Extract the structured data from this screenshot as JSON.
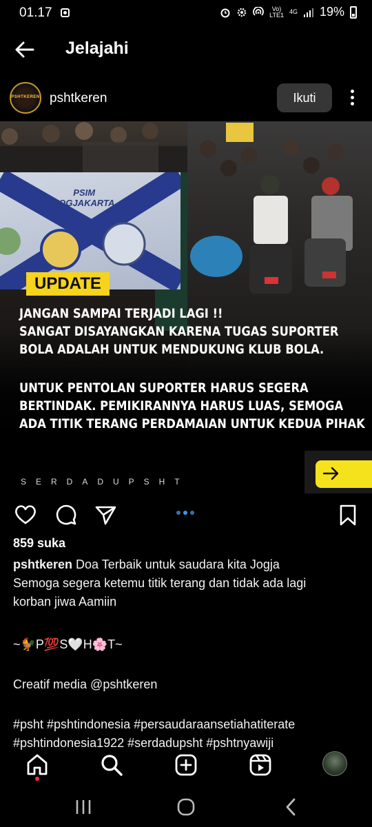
{
  "status_bar": {
    "time": "01.17",
    "network_label_top": "Vo)",
    "network_label_bottom": "LTE1",
    "network_type": "4G",
    "battery": "19%",
    "icons": [
      "screenshot-icon",
      "alarm-icon",
      "hotspot-icon",
      "signal-icon",
      "battery-icon"
    ]
  },
  "header": {
    "back_icon": "arrow-left-icon",
    "title": "Jelajahi"
  },
  "post": {
    "avatar_text": "PSHTKEREN",
    "username": "pshtkeren",
    "follow_label": "Ikuti",
    "more_icon": "more-vertical-icon",
    "image": {
      "banner_text_1": "PSIM",
      "banner_text_2": "JOGJAKARTA",
      "badge": "UPDATE",
      "text_lines_1": [
        "JANGAN SAMPAI TERJADI LAGI !!",
        "SANGAT DISAYANGKAN KARENA TUGAS SUPORTER",
        "BOLA ADALAH UNTUK MENDUKUNG KLUB BOLA."
      ],
      "text_lines_2": [
        "UNTUK PENTOLAN SUPORTER HARUS SEGERA",
        "BERTINDAK. PEMIKIRANNYA HARUS LUAS, SEMOGA",
        "ADA TITIK TERANG PERDAMAIAN UNTUK KEDUA PIHAK"
      ],
      "brand": "SERDADUPSHT",
      "next_icon": "arrow-right-icon"
    },
    "actions": {
      "like_icon": "heart-icon",
      "comment_icon": "comment-icon",
      "share_icon": "send-icon",
      "save_icon": "bookmark-icon",
      "carousel_index": 1,
      "carousel_count": 3
    },
    "likes": "859 suka",
    "caption": {
      "user": "pshtkeren",
      "line1": "Doa Terbaik untuk saudara kita Jogja",
      "line2": "Semoga segera ketemu titik terang dan tidak ada lagi",
      "line3": "korban jiwa Aamiin",
      "line4": "~🐓P💯S🤍H🌸T~",
      "line5": "Creatif media @pshtkeren",
      "line6": "#psht #pshtindonesia #persaudaraansetiahatiterate",
      "line7": "#pshtindonesia1922 #serdadupsht #pshtnyawiji"
    }
  },
  "bottom_nav": {
    "items": [
      "home-icon",
      "search-icon",
      "create-icon",
      "reels-icon",
      "profile-avatar"
    ]
  },
  "system_nav": {
    "items": [
      "recents-icon",
      "home-circle-icon",
      "back-chevron-icon"
    ]
  },
  "colors": {
    "background": "#000000",
    "badge_yellow": "#f6d31c",
    "carousel_active": "#3a97f0",
    "follow_button": "#363636",
    "notification_dot": "#ff2d4a"
  }
}
